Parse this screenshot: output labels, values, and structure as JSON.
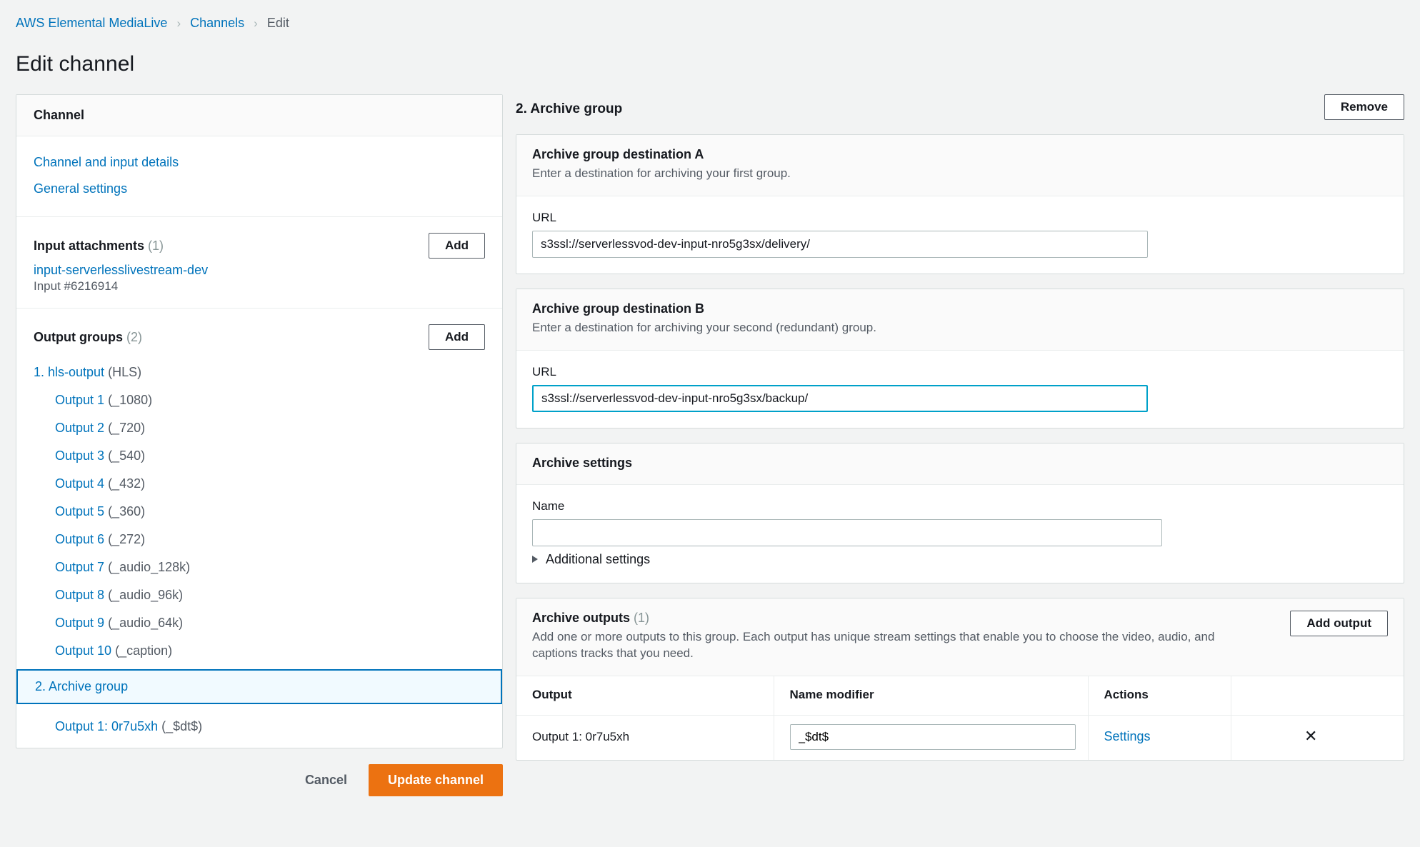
{
  "breadcrumb": {
    "items": [
      {
        "label": "AWS Elemental MediaLive",
        "current": false
      },
      {
        "label": "Channels",
        "current": false
      },
      {
        "label": "Edit",
        "current": true
      }
    ],
    "separator": "›"
  },
  "page": {
    "title": "Edit channel"
  },
  "sidebar": {
    "header": "Channel",
    "links": [
      {
        "label": "Channel and input details"
      },
      {
        "label": "General settings"
      }
    ],
    "input_attachments": {
      "title": "Input attachments",
      "count": "(1)",
      "add_label": "Add",
      "items": [
        {
          "name": "input-serverlesslivestream-dev",
          "sub": "Input #6216914"
        }
      ]
    },
    "output_groups": {
      "title": "Output groups",
      "count": "(2)",
      "add_label": "Add",
      "group1": {
        "label": "1. hls-output",
        "type": "(HLS)"
      },
      "outputs": [
        {
          "label": "Output 1",
          "modifier": "(_1080)"
        },
        {
          "label": "Output 2",
          "modifier": "(_720)"
        },
        {
          "label": "Output 3",
          "modifier": "(_540)"
        },
        {
          "label": "Output 4",
          "modifier": "(_432)"
        },
        {
          "label": "Output 5",
          "modifier": "(_360)"
        },
        {
          "label": "Output 6",
          "modifier": "(_272)"
        },
        {
          "label": "Output 7",
          "modifier": "(_audio_128k)"
        },
        {
          "label": "Output 8",
          "modifier": "(_audio_96k)"
        },
        {
          "label": "Output 9",
          "modifier": "(_audio_64k)"
        },
        {
          "label": "Output 10",
          "modifier": "(_caption)"
        }
      ],
      "group2": {
        "label": "2. Archive group",
        "selected": true
      },
      "group2_outputs": [
        {
          "label": "Output 1: 0r7u5xh",
          "modifier": "(_$dt$)"
        }
      ]
    },
    "actions": {
      "cancel_label": "Cancel",
      "update_label": "Update channel"
    }
  },
  "main": {
    "title": "2. Archive group",
    "remove_label": "Remove",
    "destination_a": {
      "title": "Archive group destination A",
      "description": "Enter a destination for archiving your first group.",
      "url_label": "URL",
      "url_value": "s3ssl://serverlessvod-dev-input-nro5g3sx/delivery/",
      "focused": false
    },
    "destination_b": {
      "title": "Archive group destination B",
      "description": "Enter a destination for archiving your second (redundant) group.",
      "url_label": "URL",
      "url_value": "s3ssl://serverlessvod-dev-input-nro5g3sx/backup/",
      "focused": true
    },
    "archive_settings": {
      "title": "Archive settings",
      "name_label": "Name",
      "name_value": "",
      "additional_label": "Additional settings"
    },
    "archive_outputs": {
      "title": "Archive outputs",
      "count": "(1)",
      "description": "Add one or more outputs to this group. Each output has unique stream settings that enable you to choose the video, audio, and captions tracks that you need.",
      "add_output_label": "Add output",
      "columns": [
        "Output",
        "Name modifier",
        "Actions",
        ""
      ],
      "rows": [
        {
          "output": "Output 1: 0r7u5xh",
          "name_modifier": "_$dt$",
          "action_label": "Settings",
          "remove_icon": "✕"
        }
      ]
    }
  },
  "colors": {
    "link": "#0073bb",
    "accent_primary": "#ec7211",
    "focus_border": "#00a1c9",
    "selected_bg": "#f1faff",
    "page_bg": "#f2f3f3"
  }
}
